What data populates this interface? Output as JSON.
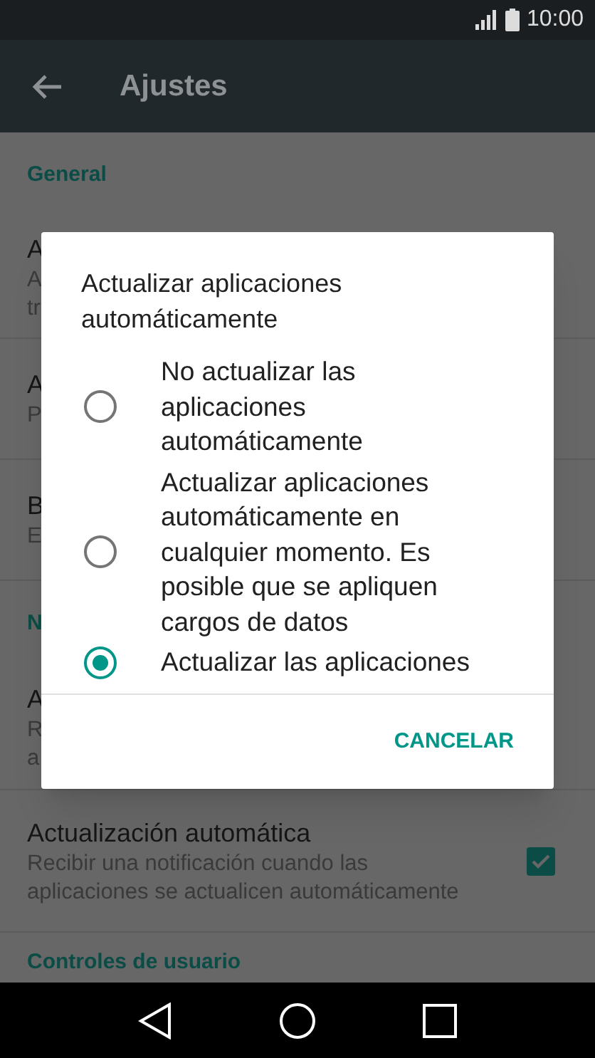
{
  "status_bar": {
    "time": "10:00"
  },
  "app_bar": {
    "title": "Ajustes"
  },
  "settings": [
    {
      "kind": "header",
      "title": "General"
    },
    {
      "kind": "item",
      "title": "A",
      "summary": [
        "A",
        "tr"
      ]
    },
    {
      "kind": "item",
      "title": "A",
      "summary": [
        "P"
      ]
    },
    {
      "kind": "item",
      "title": "B",
      "summary": [
        "E"
      ]
    },
    {
      "kind": "header",
      "title": "N"
    },
    {
      "kind": "item",
      "title": "A",
      "summary": [
        "R",
        "a"
      ]
    },
    {
      "kind": "item",
      "title": "Actualización automática",
      "summary": [
        "Recibir una notificación cuando las aplicaciones se actualicen automáticamente"
      ],
      "checked": true
    },
    {
      "kind": "header",
      "title": "Controles de usuario"
    }
  ],
  "dialog": {
    "title": "Actualizar aplicaciones automáticamente",
    "options": [
      {
        "label": "No actualizar las aplicaciones automáticamente",
        "selected": false
      },
      {
        "label": "Actualizar aplicaciones automáticamente en cualquier momento. Es posible que se apliquen cargos de datos",
        "selected": false
      },
      {
        "label": "Actualizar las aplicaciones",
        "selected": true
      }
    ],
    "buttons": [
      "CANCELAR"
    ]
  }
}
